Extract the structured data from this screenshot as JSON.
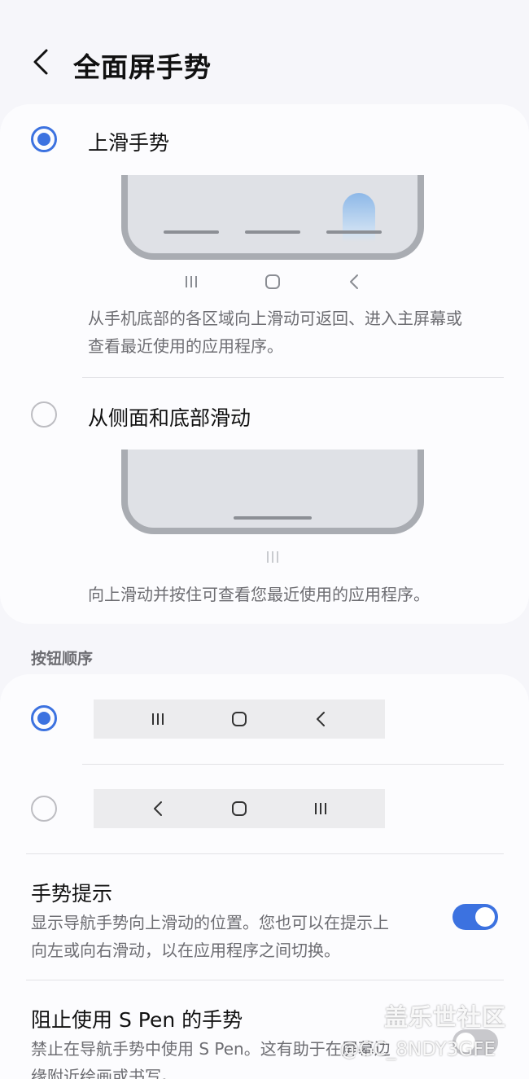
{
  "header": {
    "title": "全面屏手势",
    "back_icon": "chevron-left-icon"
  },
  "gesture_options": [
    {
      "label": "上滑手势",
      "selected": true,
      "description_line1": "从手机底部的各区域向上滑动可返回、进入主屏幕或",
      "description_line2": "查看最近使用的应用程序。",
      "icons": [
        "recents-icon",
        "home-icon",
        "back-icon"
      ]
    },
    {
      "label": "从侧面和底部滑动",
      "selected": false,
      "description": "向上滑动并按住可查看您最近使用的应用程序。",
      "icons": [
        "recents-icon"
      ]
    }
  ],
  "button_order": {
    "section_title": "按钮顺序",
    "options": [
      {
        "selected": true,
        "icons": [
          "recents-icon",
          "home-icon",
          "back-icon"
        ]
      },
      {
        "selected": false,
        "icons": [
          "back-icon",
          "home-icon",
          "recents-icon"
        ]
      }
    ]
  },
  "gesture_hint": {
    "title": "手势提示",
    "description_line1": "显示导航手势向上滑动的位置。您也可以在提示上",
    "description_line2": "向左或向右滑动，以在应用程序之间切换。",
    "enabled": true
  },
  "spen_block": {
    "title": "阻止使用 S Pen 的手势",
    "description_line1": "禁止在导航手势中使用 S Pen。这有助于在屏幕边",
    "description_line2": "缘附近绘画或书写。",
    "enabled": false
  },
  "watermark": {
    "logo": "盖乐世社区",
    "handle": "@GC_8NDY3GFE"
  },
  "colors": {
    "accent": "#3c72e0",
    "background": "#f6f6fa",
    "card": "#fcfcfe",
    "secondary_text": "#6d6d72"
  }
}
